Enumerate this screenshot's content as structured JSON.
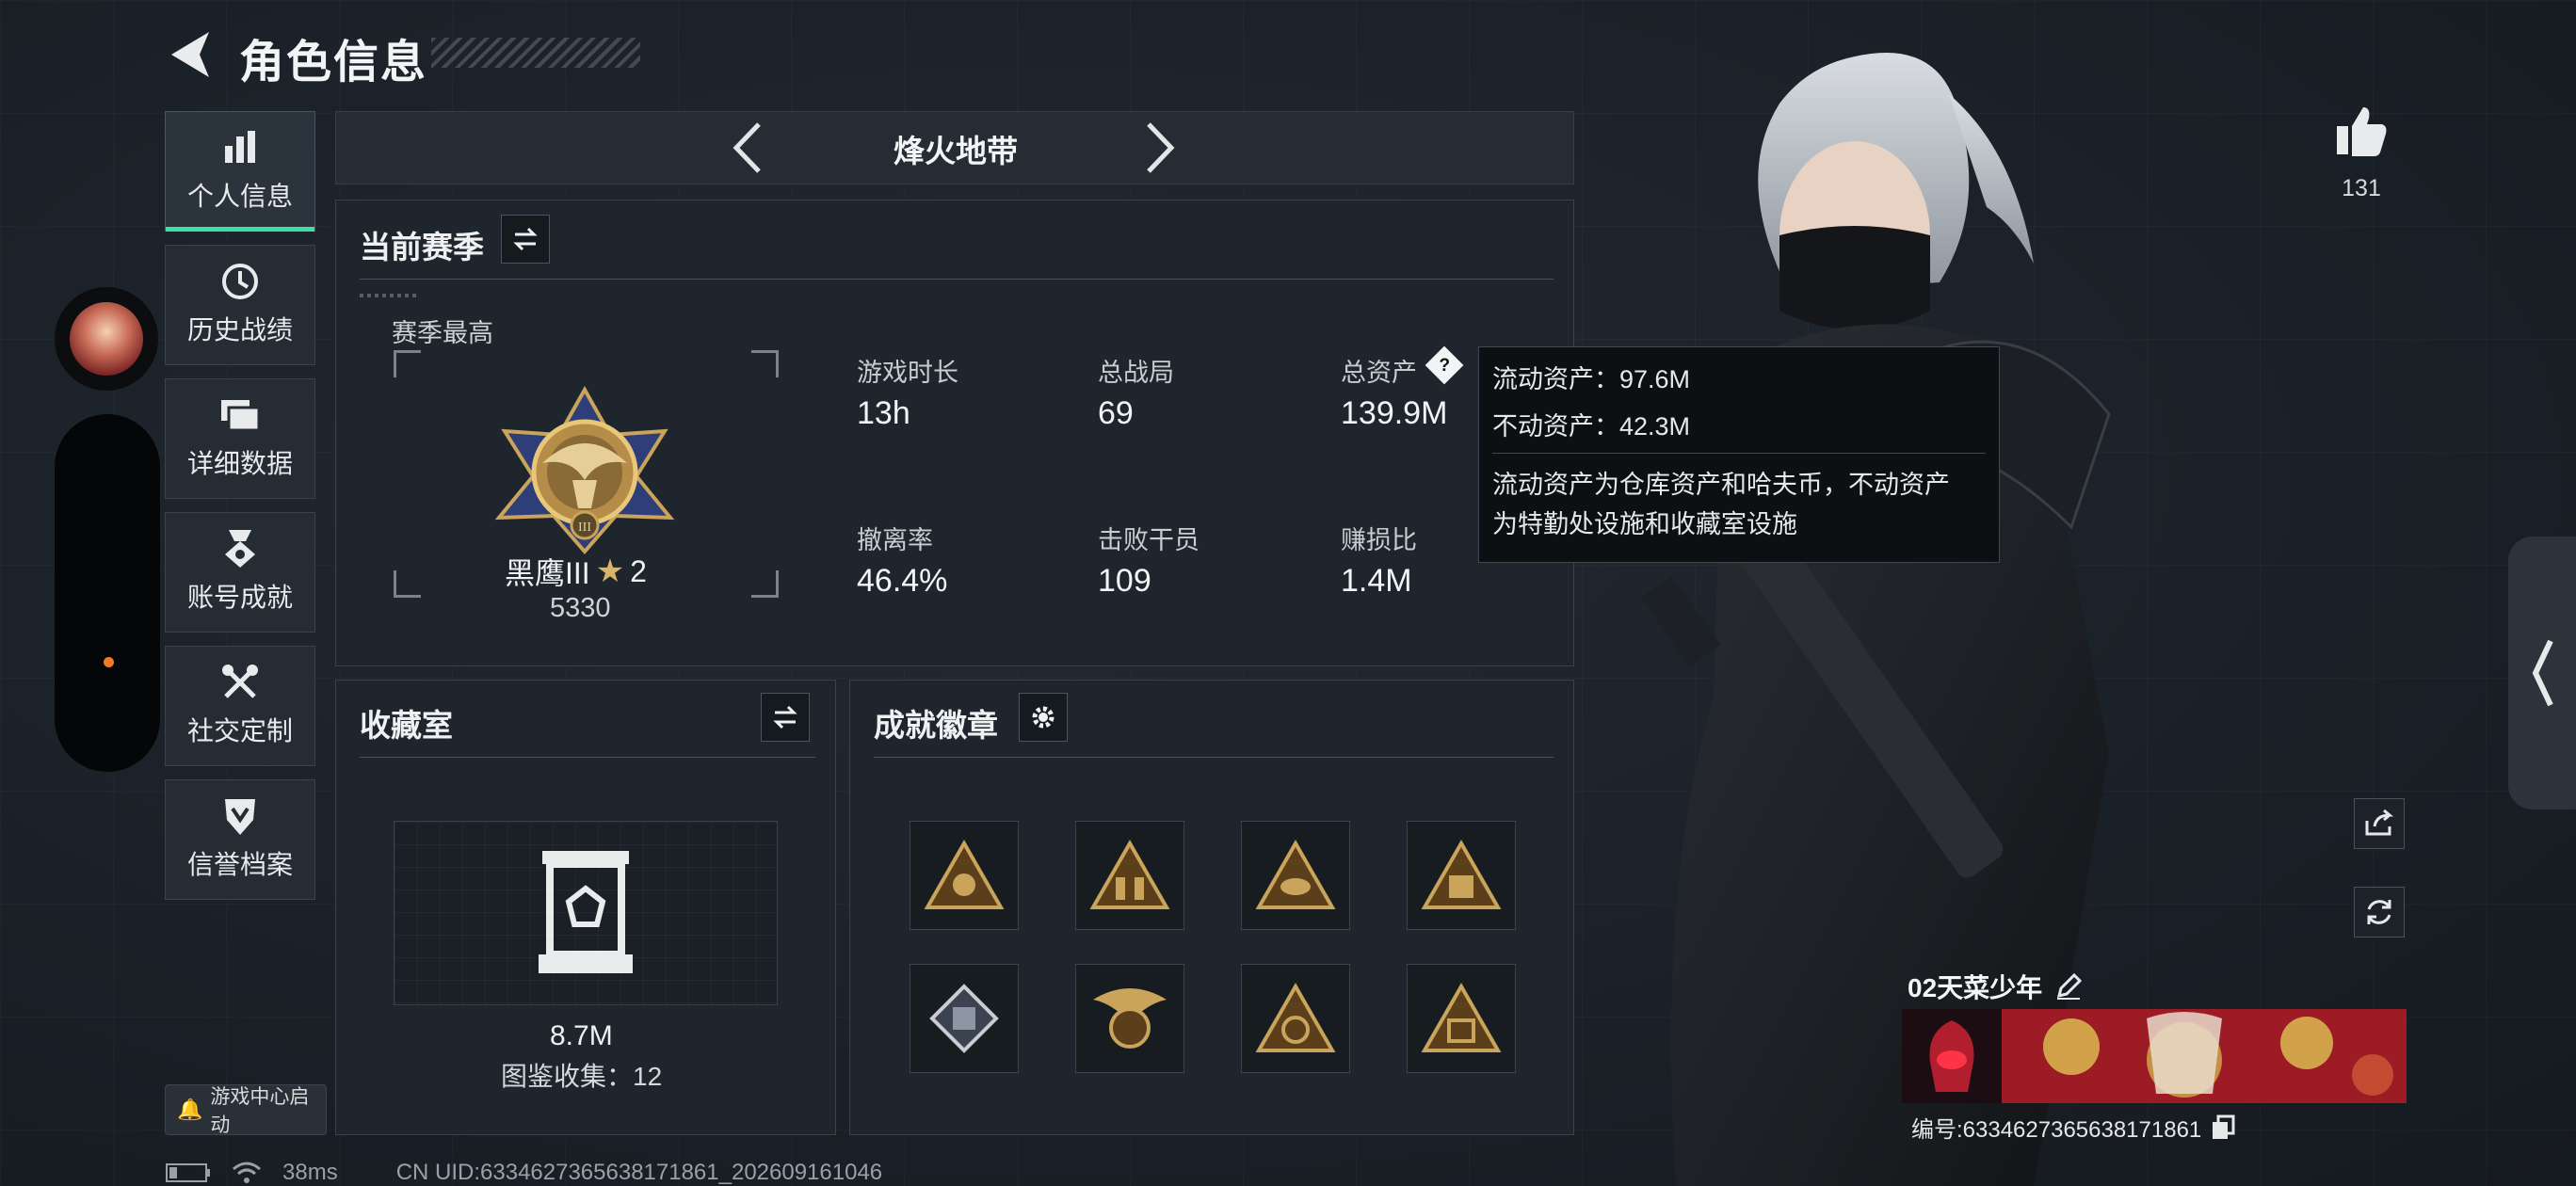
{
  "header": {
    "title": "角色信息"
  },
  "sidebar": {
    "items": [
      {
        "label": "个人信息",
        "icon": "bar-chart-icon",
        "active": true
      },
      {
        "label": "历史战绩",
        "icon": "history-clock-icon",
        "active": false
      },
      {
        "label": "详细数据",
        "icon": "folder-stack-icon",
        "active": false
      },
      {
        "label": "账号成就",
        "icon": "medal-icon",
        "active": false
      },
      {
        "label": "社交定制",
        "icon": "tools-icon",
        "active": false
      },
      {
        "label": "信誉档案",
        "icon": "shield-badge-icon",
        "active": false
      }
    ],
    "game_center_label": "游戏中心启动"
  },
  "mode_tab": {
    "label": "烽火地带"
  },
  "season_panel": {
    "title": "当前赛季",
    "best_label": "赛季最高",
    "rank_name": "黑鹰III",
    "rank_stars": "2",
    "rank_score": "5330",
    "stats": [
      {
        "label": "游戏时长",
        "value": "13h"
      },
      {
        "label": "总战局",
        "value": "69"
      },
      {
        "label": "总资产",
        "value": "139.9M"
      },
      {
        "label": "撤离率",
        "value": "46.4%"
      },
      {
        "label": "击败干员",
        "value": "109"
      },
      {
        "label": "赚损比",
        "value": "1.4M"
      }
    ]
  },
  "tooltip": {
    "liquid": "流动资产：97.6M",
    "fixed": "不动资产：42.3M",
    "desc_line1": "流动资产为仓库资产和哈夫币，不动资产",
    "desc_line2": "为特勤处设施和收藏室设施"
  },
  "collection_panel": {
    "title": "收藏室",
    "value": "8.7M",
    "catalog": "图鉴收集：12"
  },
  "achievement_panel": {
    "title": "成就徽章",
    "badges": [
      "triangle-emblem-icon",
      "triangle-soldiers-icon",
      "triangle-eye-icon",
      "triangle-box-icon",
      "cube-crate-icon",
      "eagle-crest-icon",
      "triangle-s9-icon",
      "triangle-s8-icon"
    ]
  },
  "profile": {
    "likes": "131",
    "player_name": "02天菜少年",
    "player_id": "编号:6334627365638171861"
  },
  "status_bar": {
    "ping": "38ms",
    "uid": "CN UID:6334627365638171861_202609161046"
  },
  "colors": {
    "accent": "#3ee0a0",
    "gold": "#c9a45a",
    "panel": "#1f252c"
  }
}
